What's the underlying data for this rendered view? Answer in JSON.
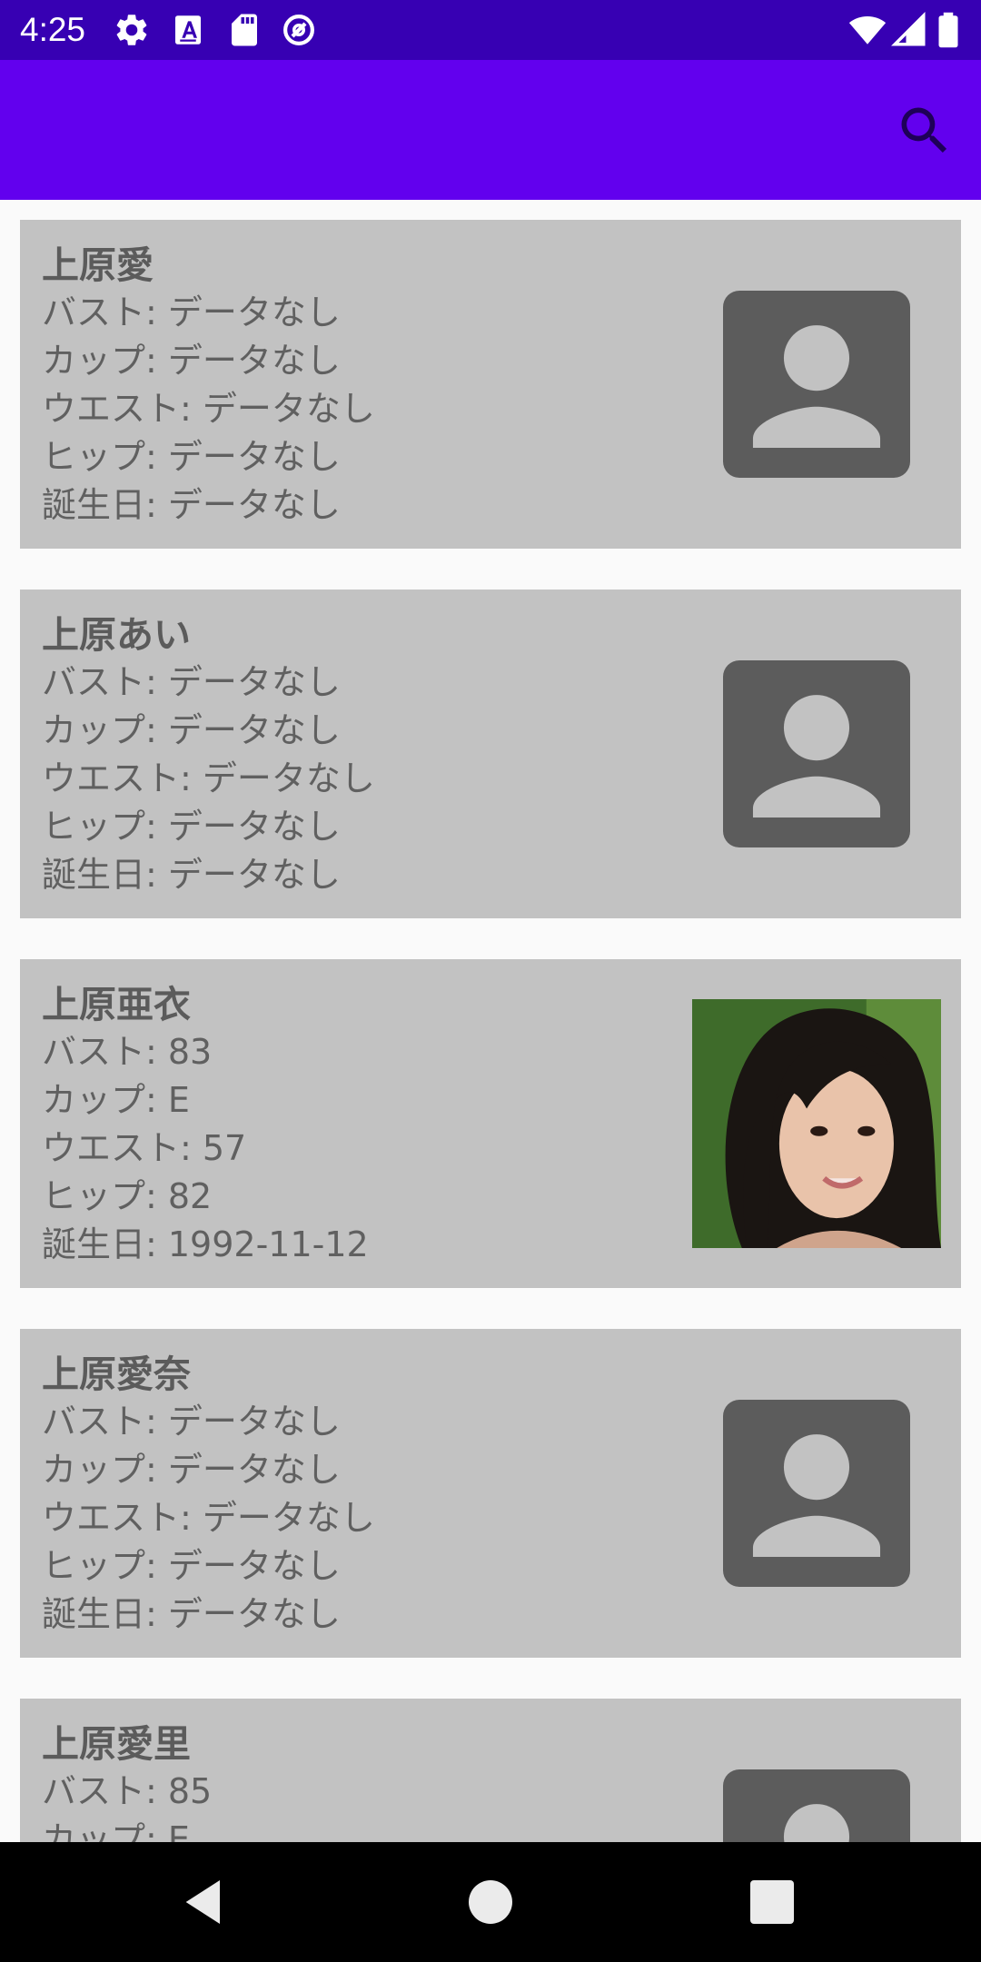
{
  "status_bar": {
    "time": "4:25",
    "background": "#3700B3",
    "icons": [
      "settings-icon",
      "text-a-icon",
      "sd-card-icon",
      "data-saver-icon",
      "wifi-icon",
      "cellular-signal-icon",
      "battery-icon"
    ]
  },
  "app_bar": {
    "background": "#6200EE",
    "search_icon": "search-icon"
  },
  "cards": [
    {
      "name": "上原愛",
      "bust": "バスト: データなし",
      "cup": "カップ: データなし",
      "waist": "ウエスト: データなし",
      "hip": "ヒップ: データなし",
      "birthday": "誕生日: データなし",
      "image": "avatar-placeholder-icon"
    },
    {
      "name": "上原あい",
      "bust": "バスト: データなし",
      "cup": "カップ: データなし",
      "waist": "ウエスト: データなし",
      "hip": "ヒップ: データなし",
      "birthday": "誕生日: データなし",
      "image": "avatar-placeholder-icon"
    },
    {
      "name": "上原亜衣",
      "bust": "バスト: 83",
      "cup": "カップ: E",
      "waist": "ウエスト: 57",
      "hip": "ヒップ: 82",
      "birthday": "誕生日: 1992-11-12",
      "image": "profile-photo"
    },
    {
      "name": "上原愛奈",
      "bust": "バスト: データなし",
      "cup": "カップ: データなし",
      "waist": "ウエスト: データなし",
      "hip": "ヒップ: データなし",
      "birthday": "誕生日: データなし",
      "image": "avatar-placeholder-icon"
    },
    {
      "name": "上原愛里",
      "bust": "バスト: 85",
      "cup": "カップ: E",
      "waist": "",
      "hip": "",
      "birthday": "",
      "image": "avatar-placeholder-icon"
    }
  ],
  "colors": {
    "card_background": "#C2C2C2",
    "list_background": "#FAFAFA",
    "placeholder": "#5C5C5C",
    "text": "#606060"
  },
  "nav_bar": {
    "icons": [
      "back-icon",
      "home-icon",
      "recents-icon"
    ]
  }
}
